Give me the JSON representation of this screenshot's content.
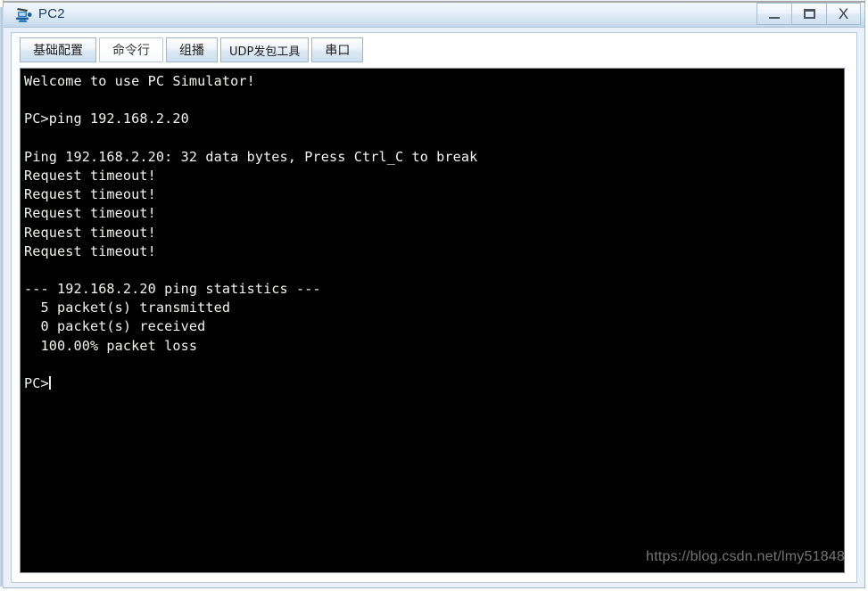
{
  "window": {
    "title": "PC2",
    "icon": "pc-network-device-icon",
    "buttons": {
      "minimize": "—",
      "maximize": "▭",
      "close": "X"
    }
  },
  "tabs": [
    {
      "label": "基础配置",
      "active": false,
      "name": "tab-basic-config"
    },
    {
      "label": "命令行",
      "active": true,
      "name": "tab-command-line"
    },
    {
      "label": "组播",
      "active": false,
      "name": "tab-multicast"
    },
    {
      "label": "UDP发包工具",
      "active": false,
      "name": "tab-udp-tool"
    },
    {
      "label": "串口",
      "active": false,
      "name": "tab-serial-port"
    }
  ],
  "terminal": {
    "background": "#000000",
    "foreground": "#f4f4ee",
    "lines": [
      "Welcome to use PC Simulator!",
      "",
      "PC>ping 192.168.2.20",
      "",
      "Ping 192.168.2.20: 32 data bytes, Press Ctrl_C to break",
      "Request timeout!",
      "Request timeout!",
      "Request timeout!",
      "Request timeout!",
      "Request timeout!",
      "",
      "--- 192.168.2.20 ping statistics ---",
      "  5 packet(s) transmitted",
      "  0 packet(s) received",
      "  100.00% packet loss",
      "",
      "PC>"
    ],
    "prompt": "PC>",
    "command": "ping 192.168.2.20",
    "target_ip": "192.168.2.20",
    "data_bytes": "32",
    "packets_transmitted": "5",
    "packets_received": "0",
    "packet_loss": "100.00%"
  },
  "watermark": {
    "text": "https://blog.csdn.net/lmy51848"
  }
}
